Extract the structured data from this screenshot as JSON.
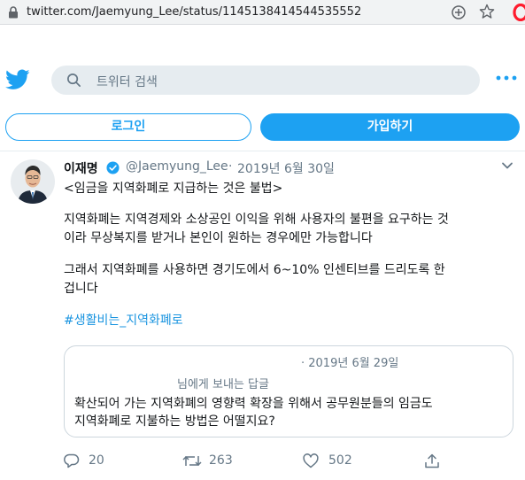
{
  "browser": {
    "url": "twitter.com/Jaemyung_Lee/status/1145138414544535552"
  },
  "header": {
    "search_placeholder": "트위터 검색"
  },
  "auth": {
    "login_label": "로그인",
    "signup_label": "가입하기"
  },
  "tweet": {
    "author_name": "이재명",
    "handle": "@Jaemyung_Lee",
    "separator": "·",
    "date": "2019년 6월 30일",
    "lines": [
      "<임금을 지역화폐로 지급하는 것은 불법>",
      "지역화폐는 지역경제와 소상공인 이익을 위해 사용자의 불편을 요구하는 것",
      "이라 무상복지를 받거나 본인이 원하는 경우에만 가능합니다",
      "그래서 지역화폐를 사용하면 경기도에서 6~10% 인센티브를 드리도록 한",
      "겁니다"
    ],
    "hashtag": "#생활비는_지역화폐로",
    "quoted": {
      "date": "· 2019년 6월 29일",
      "replying_to": "님에게 보내는 답글",
      "lines": [
        "확산되어 가는 지역화폐의 영향력 확장을 위해서 공무원분들의 임금도",
        "지역화폐로 지불하는 방법은 어떨지요?"
      ]
    },
    "actions": {
      "replies": "20",
      "retweets": "263",
      "likes": "502"
    }
  },
  "colors": {
    "brand": "#1da1f2",
    "hashtag": "#1b95e0",
    "secondary_text": "#657786"
  },
  "icons": [
    "lock-icon",
    "plus-circle-icon",
    "star-icon",
    "opera-icon",
    "twitter-bird-icon",
    "search-icon",
    "more-icon",
    "verified-icon",
    "chevron-down-icon",
    "reply-icon",
    "retweet-icon",
    "like-icon",
    "share-icon"
  ]
}
